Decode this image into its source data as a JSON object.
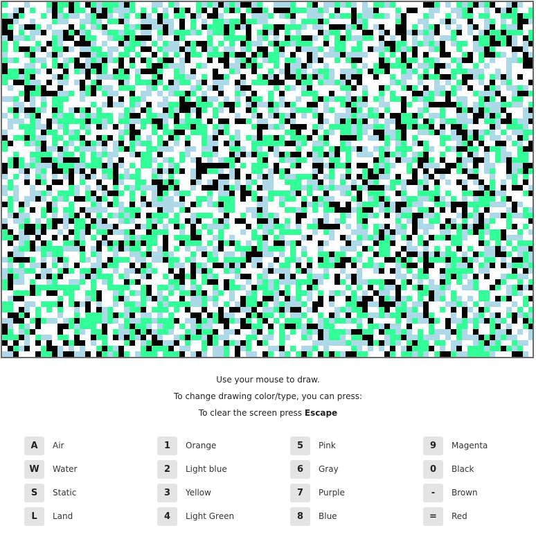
{
  "canvas": {
    "palette": {
      "air": "#ffffff",
      "water": "#add8e6",
      "static": "#000000",
      "land": "#33ff99"
    }
  },
  "instructions": {
    "line1": "Use your mouse to draw.",
    "line2": "To change drawing color/type, you can press:",
    "line3_prefix": "To clear the screen press ",
    "line3_key": "Escape"
  },
  "legend": {
    "columns": [
      [
        {
          "key": "A",
          "label": "Air"
        },
        {
          "key": "W",
          "label": "Water"
        },
        {
          "key": "S",
          "label": "Static"
        },
        {
          "key": "L",
          "label": "Land"
        }
      ],
      [
        {
          "key": "1",
          "label": "Orange"
        },
        {
          "key": "2",
          "label": "Light blue"
        },
        {
          "key": "3",
          "label": "Yellow"
        },
        {
          "key": "4",
          "label": "Light Green"
        }
      ],
      [
        {
          "key": "5",
          "label": "Pink"
        },
        {
          "key": "6",
          "label": "Gray"
        },
        {
          "key": "7",
          "label": "Purple"
        },
        {
          "key": "8",
          "label": "Blue"
        }
      ],
      [
        {
          "key": "9",
          "label": "Magenta"
        },
        {
          "key": "0",
          "label": "Black"
        },
        {
          "key": "-",
          "label": "Brown"
        },
        {
          "key": "=",
          "label": "Red"
        }
      ]
    ]
  }
}
